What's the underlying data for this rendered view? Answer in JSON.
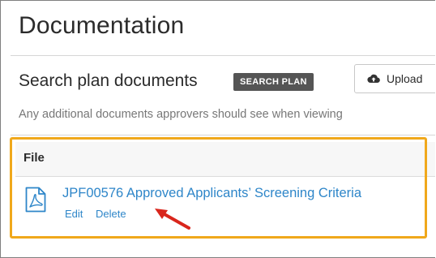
{
  "header": {
    "title": "Documentation"
  },
  "search": {
    "label": "Search plan documents",
    "badge": "SEARCH PLAN"
  },
  "upload": {
    "label": "Upload",
    "icon": "cloud-upload-icon"
  },
  "description": "Any additional documents approvers should see when viewing",
  "table": {
    "columns": [
      "File"
    ],
    "rows": [
      {
        "file_name": "JPF00576 Approved Applicants’ Screening Criteria",
        "icon": "pdf-file-icon",
        "actions": {
          "edit": "Edit",
          "delete": "Delete"
        }
      }
    ]
  },
  "colors": {
    "link": "#2e86c9",
    "highlight": "#f0a81b",
    "annotation_arrow": "#d9261c",
    "badge_bg": "#555555"
  }
}
